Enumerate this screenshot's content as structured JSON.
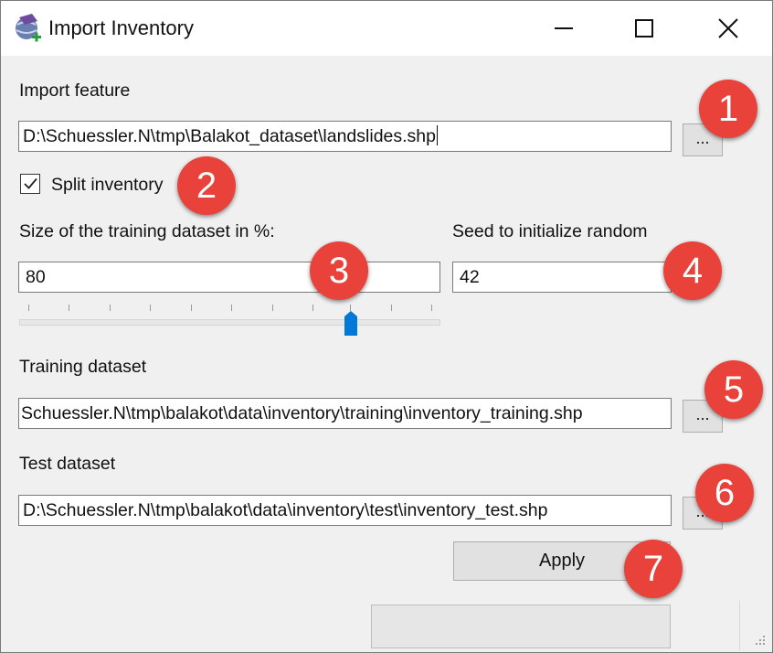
{
  "window": {
    "title": "Import Inventory",
    "icon": "qgis-globe-icon"
  },
  "import_feature": {
    "label": "Import feature",
    "path": "D:\\Schuessler.N\\tmp\\Balakot_dataset\\landslides.shp",
    "browse_label": "..."
  },
  "split_inventory": {
    "label": "Split inventory",
    "checked": true
  },
  "training_size": {
    "label": "Size of the training dataset in %:",
    "value": "80",
    "slider_fraction": 0.8
  },
  "seed": {
    "label": "Seed to initialize random",
    "value": "42"
  },
  "training_dataset": {
    "label": "Training dataset",
    "path": "Schuessler.N\\tmp\\balakot\\data\\inventory\\training\\inventory_training.shp",
    "browse_label": "..."
  },
  "test_dataset": {
    "label": "Test dataset",
    "path": "D:\\Schuessler.N\\tmp\\balakot\\data\\inventory\\test\\inventory_test.shp",
    "browse_label": "..."
  },
  "apply_label": "Apply",
  "annotations": [
    "1",
    "2",
    "3",
    "4",
    "5",
    "6",
    "7"
  ],
  "colors": {
    "badge": "#e8423b",
    "slider_handle": "#0078d7"
  }
}
